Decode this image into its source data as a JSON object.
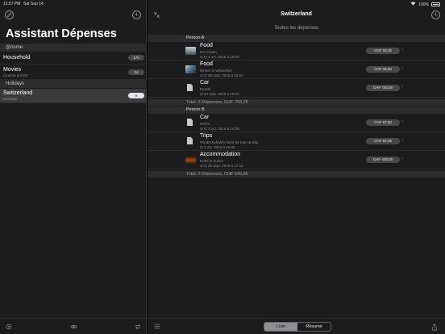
{
  "status": {
    "time": "12:57 PM",
    "date": "Sat Sep 14",
    "battery": "100%"
  },
  "sidebar": {
    "title": "Assistant Dépenses",
    "groups": [
      {
        "header": "@home"
      },
      {
        "header": "Holidays"
      }
    ],
    "items": [
      {
        "name": "Household",
        "sub": "",
        "count": "175"
      },
      {
        "name": "Movies",
        "sub": "Cinema & DVD",
        "count": "24"
      },
      {
        "name": "Switzerland",
        "sub": "Example",
        "count": "6"
      }
    ]
  },
  "main": {
    "title": "Switzerland",
    "filter": "Toutes les dépenses",
    "sections": [
      {
        "header": "Person A",
        "total": "Total: 3 Dépenses, CHF 793,25",
        "rows": [
          {
            "title": "Food",
            "desc": "Ice Cream",
            "meta": "3 oct. 2015 à 16:00",
            "amount": "CHF 18,25",
            "thumb": "img1"
          },
          {
            "title": "Food",
            "desc": "Dinner in Winterthur",
            "meta": "26 sept. 2015 à 19:00",
            "amount": "CHF 35,00",
            "thumb": "img2"
          },
          {
            "title": "Car",
            "desc": "Rental",
            "meta": "24 sept. 2015 à 18:00",
            "amount": "CHF 740,00",
            "thumb": "doc"
          }
        ]
      },
      {
        "header": "Person B",
        "total": "Total: 3 Dépenses, CHF 549,85",
        "rows": [
          {
            "title": "Car",
            "desc": "Petrol",
            "meta": "3 oct. 2015 à 14:00",
            "amount": "CHF 67,50",
            "thumb": "doc"
          },
          {
            "title": "Trips",
            "desc": "Friedrichshafen fares for train & ship",
            "meta": "2 oct. 2015 à 16:00",
            "amount": "CHF 52,35",
            "thumb": "doc"
          },
          {
            "title": "Accommodation",
            "desc": "Hotel in Zurich",
            "meta": "26 sept. 2015 à 17:15",
            "amount": "CHF 430,00",
            "thumb": "img3"
          }
        ]
      }
    ],
    "segments": {
      "list": "Liste",
      "summary": "Résumé"
    }
  },
  "icons": {
    "sidebar_edit": "pencil-circle-icon",
    "sidebar_add": "plus-circle-icon",
    "settings": "gear-icon",
    "eye": "eye-icon",
    "sync": "repeat-icon",
    "collapse": "collapse-arrows-icon",
    "filter": "filter-lines-icon",
    "share": "share-icon"
  }
}
